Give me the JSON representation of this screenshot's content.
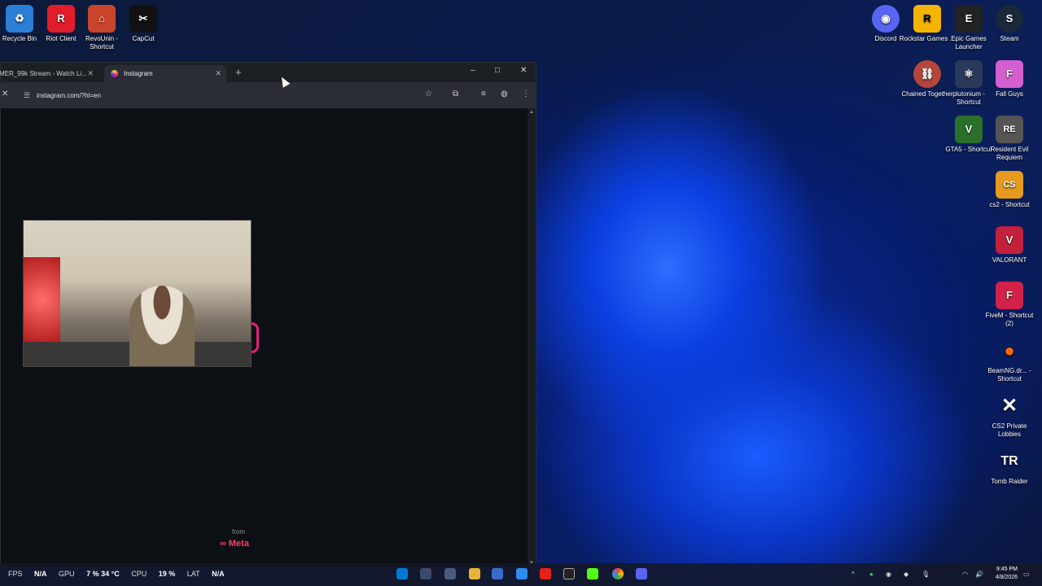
{
  "desktop": {
    "icons": [
      {
        "label": "Recycle Bin",
        "color": "#2b7fd6",
        "glyph": "♻"
      },
      {
        "label": "Riot Client",
        "color": "#e21d2b",
        "glyph": "R"
      },
      {
        "label": "RevoUnin - Shortcut",
        "color": "#c8442b",
        "glyph": "⌂"
      },
      {
        "label": "CapCut",
        "color": "#111111",
        "glyph": "✂"
      },
      {
        "label": "Discord",
        "color": "#5865f2",
        "glyph": "◉"
      },
      {
        "label": "Rockstar Games ...",
        "color": "#f4b400",
        "glyph": "R"
      },
      {
        "label": "Epic Games Launcher",
        "color": "#222222",
        "glyph": "E"
      },
      {
        "label": "Steam",
        "color": "#1b2838",
        "glyph": "S"
      },
      {
        "label": "Chained Together",
        "color": "#b3453a",
        "glyph": "⛓"
      },
      {
        "label": "plutonium - Shortcut",
        "color": "#2a3a5a",
        "glyph": "⚛"
      },
      {
        "label": "Fall Guys",
        "color": "#d35fd0",
        "glyph": "F"
      },
      {
        "label": "GTA5 - Shortcut",
        "color": "#2a6f2a",
        "glyph": "V"
      },
      {
        "label": "Resident Evil Requiem",
        "color": "#555555",
        "glyph": "RE"
      },
      {
        "label": "cs2 - Shortcut",
        "color": "#e69a1e",
        "glyph": "CS"
      },
      {
        "label": "VALORANT",
        "color": "#c2203b",
        "glyph": "V"
      },
      {
        "label": "FiveM - Shortcut (2)",
        "color": "#d1234a",
        "glyph": "F"
      },
      {
        "label": "BeamNG.dr... - Shortcut",
        "color": "#ff6a00",
        "glyph": "●"
      },
      {
        "label": "CS2 Private Lobbies",
        "color": "#1d1d1d",
        "glyph": "✕"
      },
      {
        "label": "Tomb Raider",
        "color": "#111111",
        "glyph": "TR"
      }
    ]
  },
  "browser": {
    "tabs": [
      {
        "label": "MER_99k Stream - Watch Li..."
      },
      {
        "label": "Instagram"
      }
    ],
    "new_tab": "+",
    "minimize": "–",
    "maximize": "□",
    "close": "✕",
    "url": "instagram.com/?hl=en"
  },
  "page": {
    "from": "from",
    "meta": "∞ Meta"
  },
  "taskbar": {
    "overlay": {
      "fps_label": "FPS",
      "fps_value": "N/A",
      "gpu_label": "GPU",
      "gpu_value": "7 %  34 °C",
      "cpu_label": "CPU",
      "cpu_value": "19 %",
      "lat_label": "LAT",
      "lat_value": "N/A"
    },
    "time": "9:45 PM",
    "date": "4/8/2026"
  }
}
